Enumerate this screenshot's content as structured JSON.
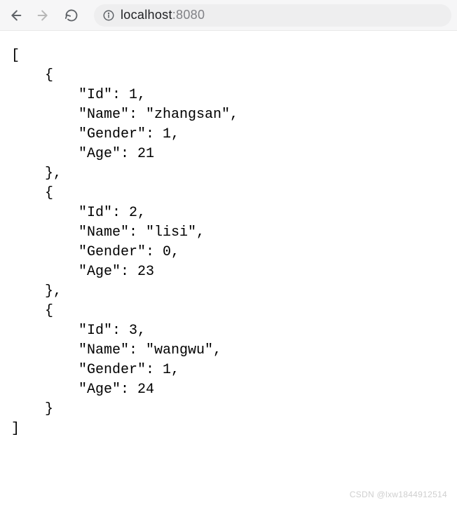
{
  "address": {
    "host": "localhost",
    "port": ":8080"
  },
  "response": {
    "records": [
      {
        "Id": 1,
        "Name": "zhangsan",
        "Gender": 1,
        "Age": 21
      },
      {
        "Id": 2,
        "Name": "lisi",
        "Gender": 0,
        "Age": 23
      },
      {
        "Id": 3,
        "Name": "wangwu",
        "Gender": 1,
        "Age": 24
      }
    ]
  },
  "watermark": {
    "text": "CSDN @lxw1844912514"
  }
}
